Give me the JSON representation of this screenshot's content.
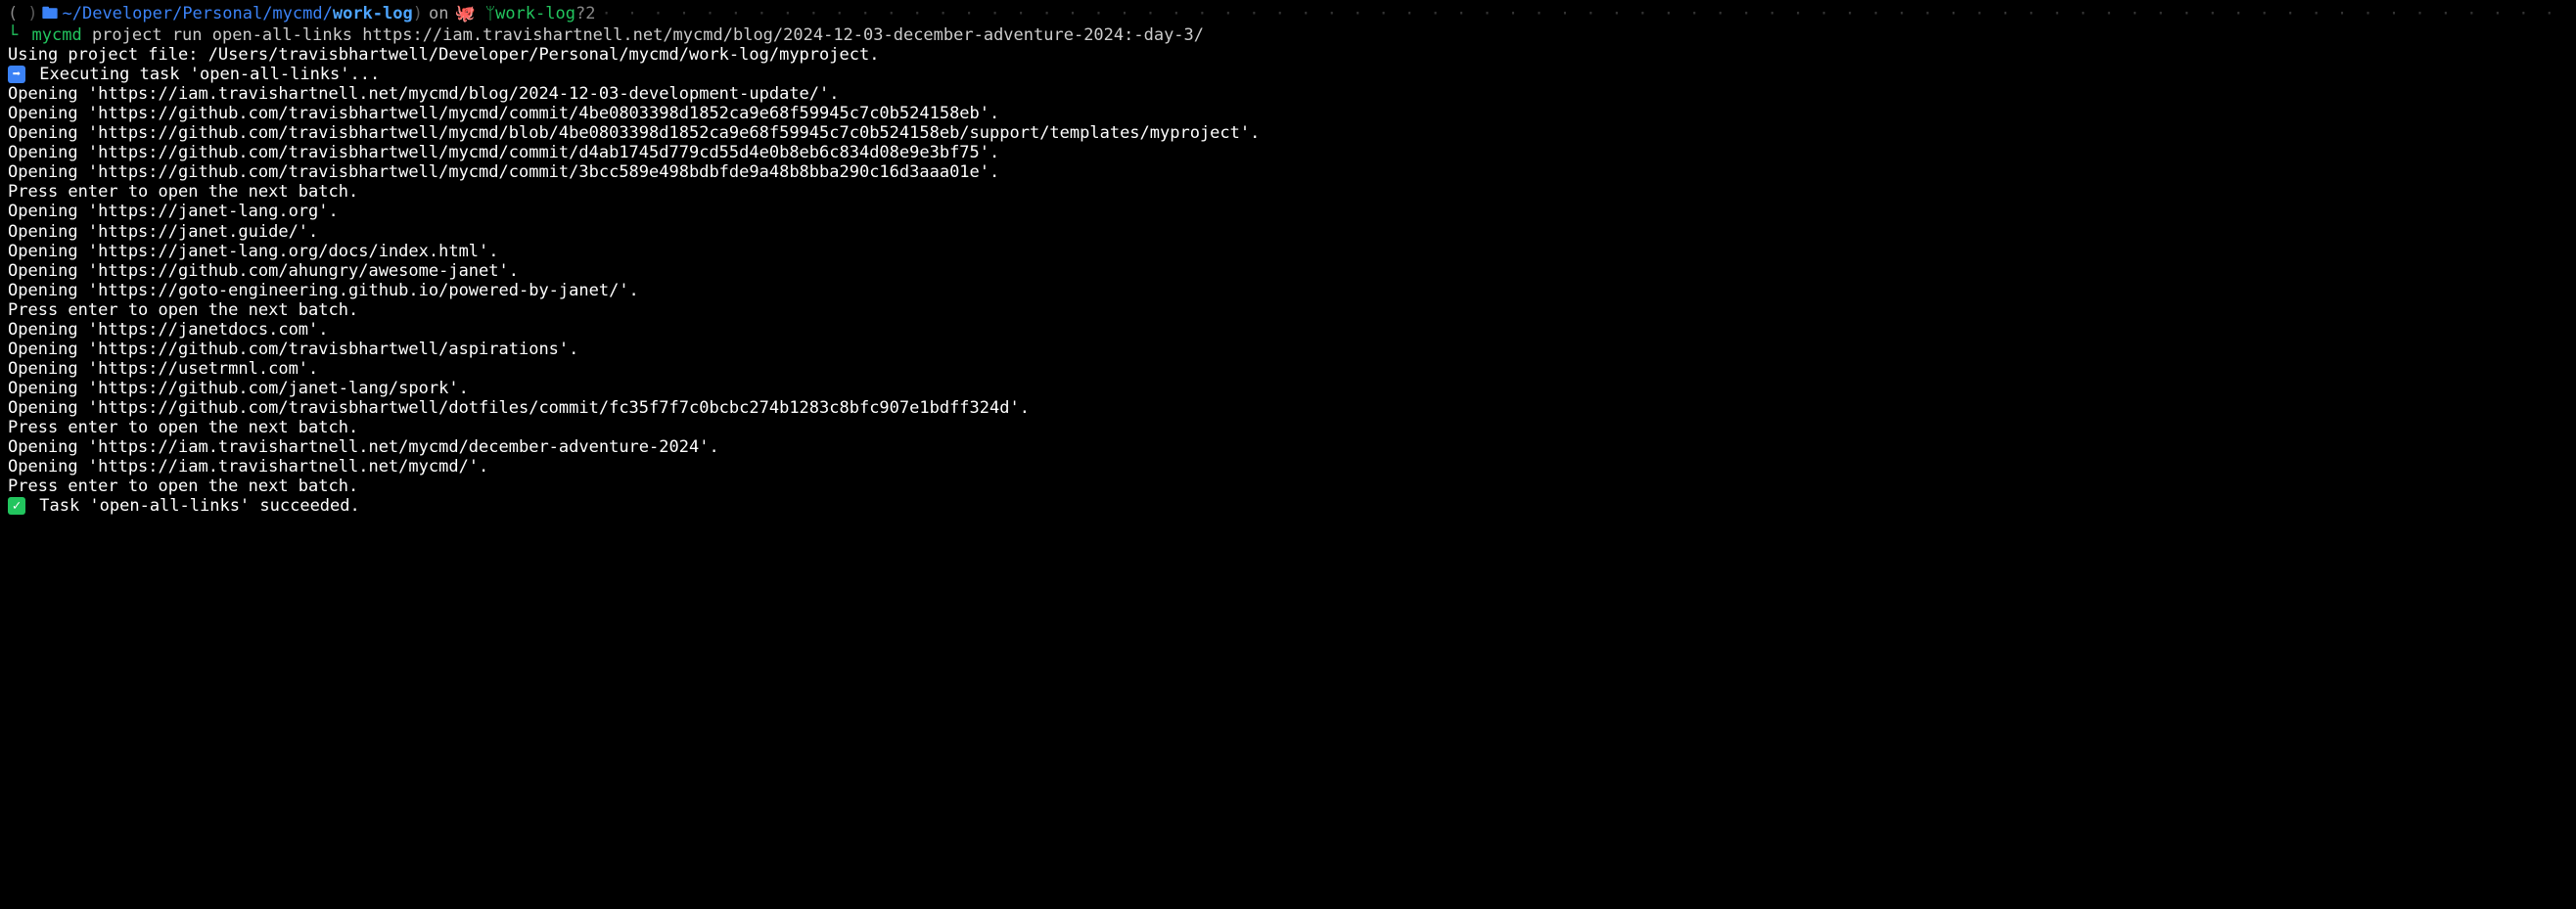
{
  "prompt": {
    "path_parent": "~/Developer/Personal/mycmd/",
    "path_leaf": "work-log",
    "on": "on",
    "branch": "work-log",
    "branch_status": "?2",
    "dots": "· · · · · · · · · · · · · · · · · · · · · · · · · · · · · · · · · · · · · · · · · · · · · · · · · · · · · · · · · · · · · · · · · · · · · · · · · · · · · · · · · · · · · · · · · · · · · · · · · · · · · · · · · · · · · · · · · · · · · · · · · · · · · · · · · · · · · · · · · · · · · · · · · · · · · · · · · · · · · · · · · · · · · · · · · · · · · · · · · · · · · ·"
  },
  "command": {
    "name": "mycmd",
    "args": "project run open-all-links https://iam.travishartnell.net/mycmd/blog/2024-12-03-december-adventure-2024:-day-3/"
  },
  "output": {
    "line_00": "Using project file: /Users/travisbhartwell/Developer/Personal/mycmd/work-log/myproject.",
    "exec_msg": " Executing task 'open-all-links'...",
    "line_01": "Opening 'https://iam.travishartnell.net/mycmd/blog/2024-12-03-development-update/'.",
    "line_02": "Opening 'https://github.com/travisbhartwell/mycmd/commit/4be0803398d1852ca9e68f59945c7c0b524158eb'.",
    "line_03": "Opening 'https://github.com/travisbhartwell/mycmd/blob/4be0803398d1852ca9e68f59945c7c0b524158eb/support/templates/myproject'.",
    "line_04": "Opening 'https://github.com/travisbhartwell/mycmd/commit/d4ab1745d779cd55d4e0b8eb6c834d08e9e3bf75'.",
    "line_05": "Opening 'https://github.com/travisbhartwell/mycmd/commit/3bcc589e498bdbfde9a48b8bba290c16d3aaa01e'.",
    "line_06": "Press enter to open the next batch.",
    "line_07": "Opening 'https://janet-lang.org'.",
    "line_08": "Opening 'https://janet.guide/'.",
    "line_09": "Opening 'https://janet-lang.org/docs/index.html'.",
    "line_10": "Opening 'https://github.com/ahungry/awesome-janet'.",
    "line_11": "Opening 'https://goto-engineering.github.io/powered-by-janet/'.",
    "line_12": "Press enter to open the next batch.",
    "line_13": "Opening 'https://janetdocs.com'.",
    "line_14": "Opening 'https://github.com/travisbhartwell/aspirations'.",
    "line_15": "Opening 'https://usetrmnl.com'.",
    "line_16": "Opening 'https://github.com/janet-lang/spork'.",
    "line_17": "Opening 'https://github.com/travisbhartwell/dotfiles/commit/fc35f7f7c0bcbc274b1283c8bfc907e1bdff324d'.",
    "line_18": "Press enter to open the next batch.",
    "line_19": "Opening 'https://iam.travishartnell.net/mycmd/december-adventure-2024'.",
    "line_20": "Opening 'https://iam.travishartnell.net/mycmd/'.",
    "line_21": "Press enter to open the next batch.",
    "success_msg": " Task 'open-all-links' succeeded."
  }
}
